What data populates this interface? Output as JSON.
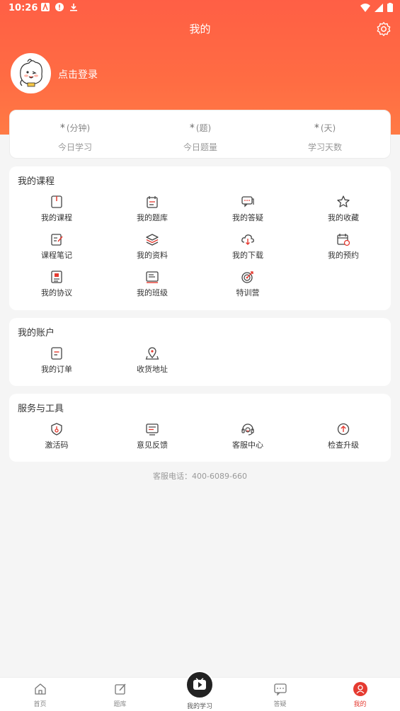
{
  "status_bar": {
    "time": "10:26"
  },
  "header": {
    "title": "我的",
    "login_text": "点击登录"
  },
  "stats": [
    {
      "value": "*",
      "unit": "(分钟)",
      "label": "今日学习"
    },
    {
      "value": "*",
      "unit": "(题)",
      "label": "今日题量"
    },
    {
      "value": "*",
      "unit": "(天)",
      "label": "学习天数"
    }
  ],
  "my_courses": {
    "title": "我的课程",
    "items": [
      {
        "label": "我的课程",
        "icon": "book-icon"
      },
      {
        "label": "我的题库",
        "icon": "calendar-list-icon"
      },
      {
        "label": "我的答疑",
        "icon": "chat-bubble-icon"
      },
      {
        "label": "我的收藏",
        "icon": "star-icon"
      },
      {
        "label": "课程笔记",
        "icon": "note-edit-icon"
      },
      {
        "label": "我的资料",
        "icon": "layers-icon"
      },
      {
        "label": "我的下载",
        "icon": "cloud-download-icon"
      },
      {
        "label": "我的预约",
        "icon": "calendar-clock-icon"
      },
      {
        "label": "我的协议",
        "icon": "contract-icon"
      },
      {
        "label": "我的班级",
        "icon": "class-list-icon"
      },
      {
        "label": "特训营",
        "icon": "target-icon"
      }
    ]
  },
  "my_account": {
    "title": "我的账户",
    "items": [
      {
        "label": "我的订单",
        "icon": "order-icon"
      },
      {
        "label": "收货地址",
        "icon": "location-icon"
      }
    ]
  },
  "services": {
    "title": "服务与工具",
    "items": [
      {
        "label": "激活码",
        "icon": "shield-key-icon"
      },
      {
        "label": "意见反馈",
        "icon": "feedback-icon"
      },
      {
        "label": "客服中心",
        "icon": "headset-icon"
      },
      {
        "label": "检查升级",
        "icon": "upgrade-icon"
      }
    ]
  },
  "hotline": "客服电话：400-6089-660",
  "tabbar": {
    "items": [
      {
        "label": "首页",
        "icon": "home-icon"
      },
      {
        "label": "题库",
        "icon": "edit-icon"
      },
      {
        "label": "我的学习",
        "icon": "play-icon"
      },
      {
        "label": "答疑",
        "icon": "message-icon"
      },
      {
        "label": "我的",
        "icon": "user-icon"
      }
    ],
    "active": "我的"
  },
  "colors": {
    "accent": "#e53a30",
    "header_top": "#ff5f45",
    "header_bottom": "#ff7a45"
  }
}
